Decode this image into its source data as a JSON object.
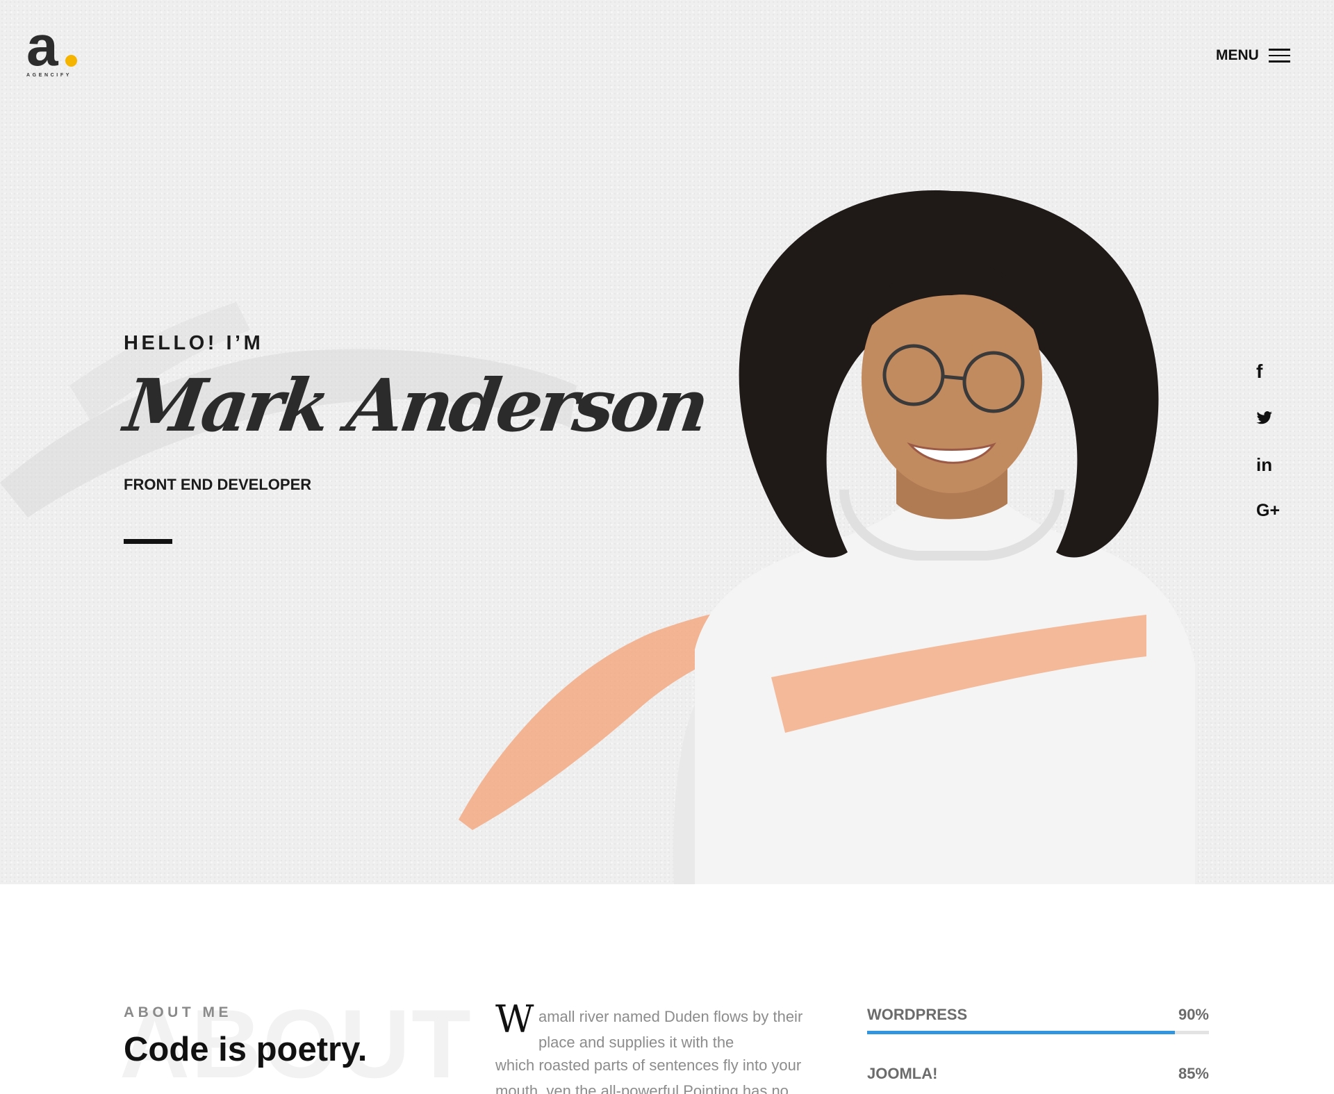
{
  "logo": {
    "letter": "a",
    "subtitle": "AGENCIFY",
    "dot_color": "#f5b400"
  },
  "nav": {
    "menu_label": "MENU"
  },
  "hero": {
    "greeting": "HELLO! I’M",
    "name": "Mark Anderson",
    "role": "FRONT END DEVELOPER",
    "brush_colors": {
      "grey": "#d9d9d9",
      "peach": "#f3a57a"
    }
  },
  "social": [
    {
      "icon": "facebook-icon",
      "glyph": "f"
    },
    {
      "icon": "twitter-icon"
    },
    {
      "icon": "linkedin-icon",
      "glyph": "in"
    },
    {
      "icon": "google-plus-icon",
      "glyph": "G+"
    }
  ],
  "about": {
    "watermark": "ABOUT",
    "kicker": "ABOUT ME",
    "heading": "Code is poetry.",
    "dropcap": "W",
    "para_top": "amall river named Duden flows by their place and supplies it with the",
    "para_bottom": "which roasted parts of sentences fly into your mouth. ven the all-powerful Pointing has no"
  },
  "skills": [
    {
      "name": "WORDPRESS",
      "percent_label": "90%",
      "value": 90
    },
    {
      "name": "JOOMLA!",
      "percent_label": "85%",
      "value": 85
    }
  ],
  "colors": {
    "accent_blue": "#3295e0",
    "text_dark": "#111111",
    "text_muted": "#8c8c8c"
  }
}
